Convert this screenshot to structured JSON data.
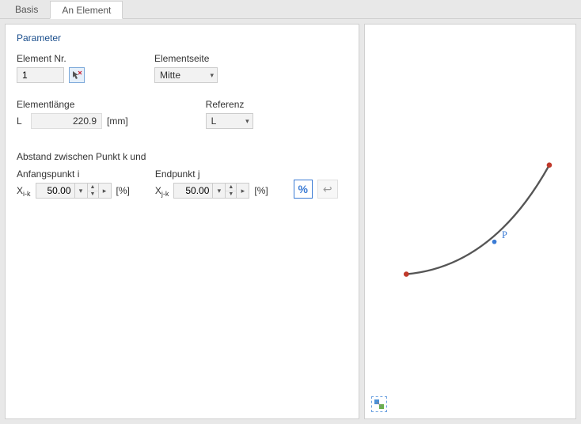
{
  "tabs": {
    "basis": "Basis",
    "an_element": "An Element"
  },
  "parameter": {
    "title": "Parameter",
    "element_nr": {
      "label": "Element Nr.",
      "value": "1"
    },
    "elementseite": {
      "label": "Elementseite",
      "value": "Mitte"
    },
    "elementlaenge": {
      "label": "Elementlänge",
      "sym": "L",
      "value": "220.9",
      "unit": "[mm]"
    },
    "referenz": {
      "label": "Referenz",
      "value": "L"
    },
    "abstand": {
      "title": "Abstand zwischen Punkt k und",
      "anfang": {
        "label": "Anfangspunkt i",
        "sym_pre": "X",
        "sym_sub": "i-k",
        "value": "50.00",
        "unit": "[%]"
      },
      "end": {
        "label": "Endpunkt j",
        "sym_pre": "X",
        "sym_sub": "j-k",
        "value": "50.00",
        "unit": "[%]"
      }
    },
    "pct_button": "%"
  },
  "icons": {
    "pointer": "pick-element-icon",
    "chevron": "▾",
    "spin_up": "▲",
    "spin_down": "▼",
    "play": "▸",
    "revert": "↩",
    "tool": "preview-tool-icon"
  },
  "preview": {
    "point_label": "P"
  }
}
